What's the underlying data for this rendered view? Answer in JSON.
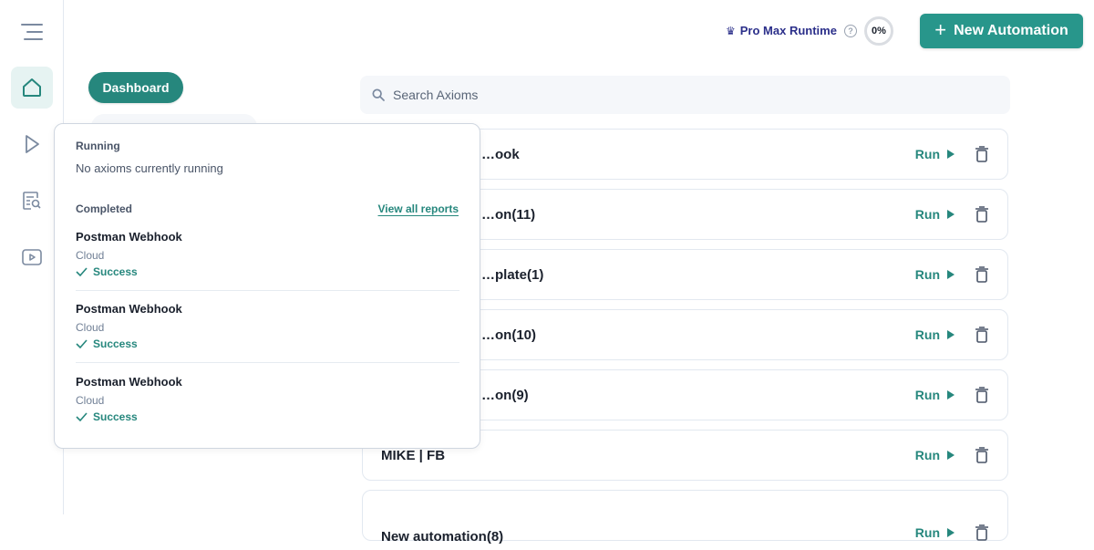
{
  "sidebar": {
    "items": [
      {
        "name": "home",
        "icon": "home-icon",
        "active": true
      },
      {
        "name": "run",
        "icon": "play-icon",
        "active": false
      },
      {
        "name": "reports",
        "icon": "report-search-icon",
        "active": false
      },
      {
        "name": "tutorials",
        "icon": "video-icon",
        "active": false
      }
    ]
  },
  "nav": {
    "dashboard_label": "Dashboard"
  },
  "topbar": {
    "plan_label": "Pro Max Runtime",
    "plan_icon": "crown-icon",
    "help_icon": "?",
    "usage_percent": "0%",
    "new_button_label": "New Automation",
    "new_button_icon": "+"
  },
  "search": {
    "placeholder": "Search Axioms",
    "value": ""
  },
  "automations": [
    {
      "name": "…ook",
      "run_label": "Run"
    },
    {
      "name": "…on(11)",
      "run_label": "Run"
    },
    {
      "name": "…plate(1)",
      "run_label": "Run"
    },
    {
      "name": "…on(10)",
      "run_label": "Run"
    },
    {
      "name": "…on(9)",
      "run_label": "Run"
    },
    {
      "name": "MIKE | FB",
      "run_label": "Run"
    },
    {
      "name": "New automation(8)",
      "run_label": "Run"
    }
  ],
  "popover": {
    "running_label": "Running",
    "running_message": "No axioms currently running",
    "completed_label": "Completed",
    "view_all_label": "View all reports",
    "reports": [
      {
        "title": "Postman Webhook",
        "type": "Cloud",
        "status": "Success"
      },
      {
        "title": "Postman Webhook",
        "type": "Cloud",
        "status": "Success"
      },
      {
        "title": "Postman Webhook",
        "type": "Cloud",
        "status": "Success"
      }
    ]
  },
  "colors": {
    "accent": "#26877d",
    "button": "#28968b",
    "plan": "#2b2f8a"
  }
}
